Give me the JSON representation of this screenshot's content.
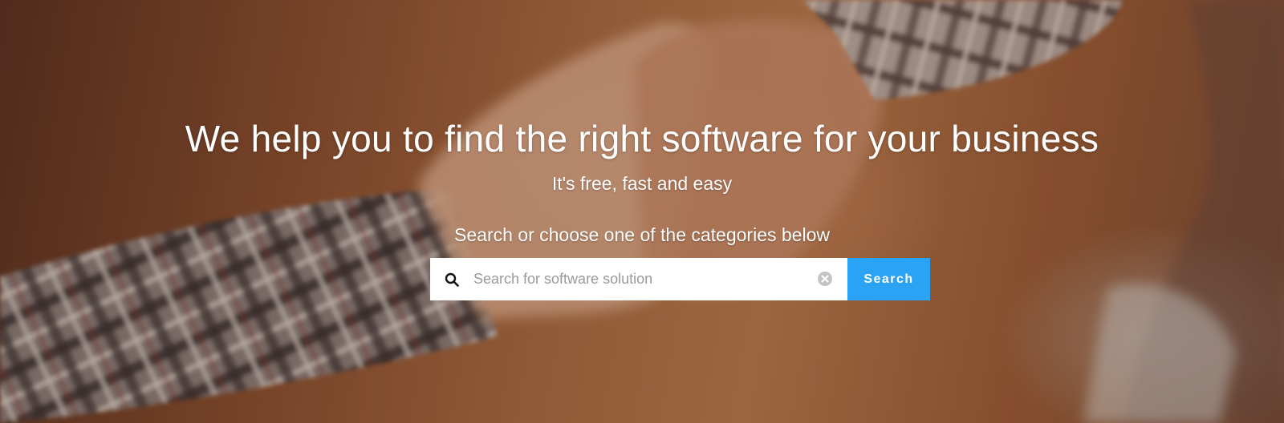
{
  "hero": {
    "headline": "We help you to find the right software for your business",
    "subline": "It's free, fast and easy",
    "prompt": "Search or choose one of the categories below"
  },
  "search": {
    "placeholder": "Search for software solution",
    "value": "",
    "button_label": "Search",
    "icon": "search-icon",
    "clear_icon": "clear-icon"
  },
  "colors": {
    "button_bg": "#2ba3f5",
    "text": "#ffffff",
    "placeholder": "#9a9a9a"
  }
}
